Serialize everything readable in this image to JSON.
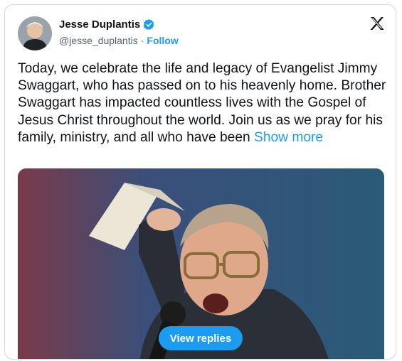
{
  "author": {
    "display_name": "Jesse Duplantis",
    "handle": "@jesse_duplantis",
    "separator": "·",
    "follow_label": "Follow",
    "verified_color": "#1d9bf0"
  },
  "tweet": {
    "text": "Today, we celebrate the life and legacy of Evangelist Jimmy Swaggart, who has passed on to his heavenly home. Brother Swaggart has impacted countless lives with the Gospel of Jesus Christ throughout the world. Join us as we pray for his family, ministry, and all who have been",
    "show_more_label": "Show more"
  },
  "actions": {
    "view_replies_label": "View replies"
  },
  "icons": {
    "platform": "x-logo-icon",
    "verified": "verified-badge-icon"
  },
  "colors": {
    "accent": "#1d9bf0",
    "secondary_text": "#536471",
    "border": "#cfd9de"
  }
}
